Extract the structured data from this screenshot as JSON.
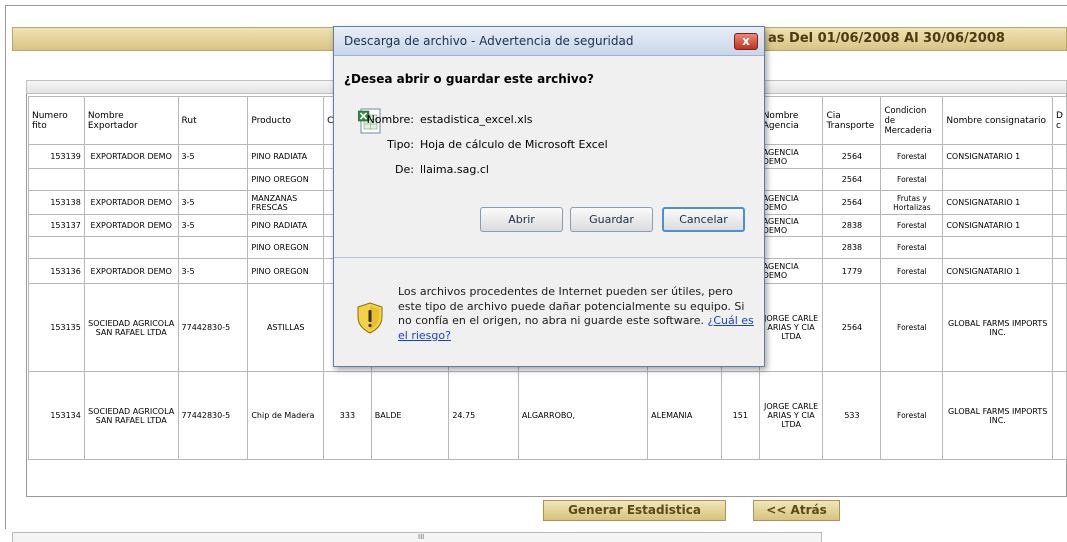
{
  "header": {
    "title_fragment": "as Del 01/06/2008 Al 30/06/2008"
  },
  "table": {
    "columns": [
      "Numero fito",
      "Nombre Exportador",
      "Rut",
      "Producto",
      "C",
      "",
      "",
      "",
      "",
      "",
      "Nombre Agencia",
      "Cia Transporte",
      "Condicion de Mercaderia",
      "Nombre consignatario",
      "D c"
    ],
    "rows": [
      {
        "fito": "153139",
        "exportador": "EXPORTADOR DEMO",
        "rut": "3-5",
        "producto": "PINO RADIATA",
        "c5": "",
        "c6": "",
        "c7": "",
        "c8": "",
        "c9": "",
        "c10": "",
        "agencia": "AGENCIA DEMO",
        "cia": "2564",
        "condicion": "Forestal",
        "consignatario": "CONSIGNATARIO 1"
      },
      {
        "fito": "",
        "exportador": "",
        "rut": "",
        "producto": "PINO OREGON",
        "c5": "",
        "c6": "",
        "c7": "",
        "c8": "",
        "c9": "",
        "c10": "",
        "agencia": "",
        "cia": "2564",
        "condicion": "Forestal",
        "consignatario": ""
      },
      {
        "fito": "153138",
        "exportador": "EXPORTADOR DEMO",
        "rut": "3-5",
        "producto": "MANZANAS FRESCAS",
        "c5": "",
        "c6": "",
        "c7": "",
        "c8": "",
        "c9": "",
        "c10": "",
        "agencia": "AGENCIA DEMO",
        "cia": "2564",
        "condicion": "Frutas y Hortalizas",
        "consignatario": "CONSIGNATARIO 1"
      },
      {
        "fito": "153137",
        "exportador": "EXPORTADOR DEMO",
        "rut": "3-5",
        "producto": "PINO RADIATA",
        "c5": "",
        "c6": "",
        "c7": "",
        "c8": "",
        "c9": "",
        "c10": "",
        "agencia": "AGENCIA DEMO",
        "cia": "2838",
        "condicion": "Forestal",
        "consignatario": "CONSIGNATARIO 1"
      },
      {
        "fito": "",
        "exportador": "",
        "rut": "",
        "producto": "PINO OREGON",
        "c5": "",
        "c6": "",
        "c7": "",
        "c8": "",
        "c9": "",
        "c10": "",
        "agencia": "",
        "cia": "2838",
        "condicion": "Forestal",
        "consignatario": ""
      },
      {
        "fito": "153136",
        "exportador": "EXPORTADOR DEMO",
        "rut": "3-5",
        "producto": "PINO OREGON",
        "c5": "",
        "c6": "",
        "c7": "",
        "c8": "",
        "c9": "",
        "c10": "",
        "agencia": "AGENCIA DEMO",
        "cia": "1779",
        "condicion": "Forestal",
        "consignatario": "CONSIGNATARIO 1"
      },
      {
        "fito": "153135",
        "exportador": "SOCIEDAD AGRICOLA SAN RAFAEL LTDA",
        "rut": "77442830-5",
        "producto": "ASTILLAS",
        "c5": "",
        "c6": "",
        "c7": "",
        "c8": "",
        "c9": "",
        "c10": "",
        "agencia": "JORGE CARLE ARIAS Y CIA LTDA",
        "cia": "2564",
        "condicion": "Forestal",
        "consignatario": "GLOBAL FARMS IMPORTS INC."
      },
      {
        "fito": "153134",
        "exportador": "SOCIEDAD AGRICOLA SAN RAFAEL LTDA",
        "rut": "77442830-5",
        "producto": "Chip de Madera",
        "c5": "333",
        "c6": "BALDE",
        "c7": "24.75",
        "c8": "ALGARROBO,",
        "c9": "ALEMANIA",
        "c10": "151",
        "agencia": "JORGE CARLE ARIAS Y CIA LTDA",
        "cia": "533",
        "condicion": "Forestal",
        "consignatario": "GLOBAL FARMS IMPORTS INC."
      }
    ]
  },
  "buttons": {
    "generar": "Generar Estadistica",
    "atras": "<< Atrás"
  },
  "scroll": {
    "grip": "III"
  },
  "dialog": {
    "title": "Descarga de archivo - Advertencia de seguridad",
    "close": "x",
    "question": "¿Desea abrir o guardar este archivo?",
    "nombre_label": "Nombre:",
    "nombre_value": "estadistica_excel.xls",
    "tipo_label": "Tipo:",
    "tipo_value": "Hoja de cálculo de Microsoft Excel",
    "de_label": "De:",
    "de_value": "llaima.sag.cl",
    "abrir": "Abrir",
    "guardar": "Guardar",
    "cancelar": "Cancelar",
    "warning_text": "Los archivos procedentes de Internet pueden ser útiles, pero este tipo de archivo puede dañar potencialmente su equipo. Si no confía en el origen, no abra ni guarde este software.",
    "risk_link": "¿Cuál es el riesgo?"
  }
}
